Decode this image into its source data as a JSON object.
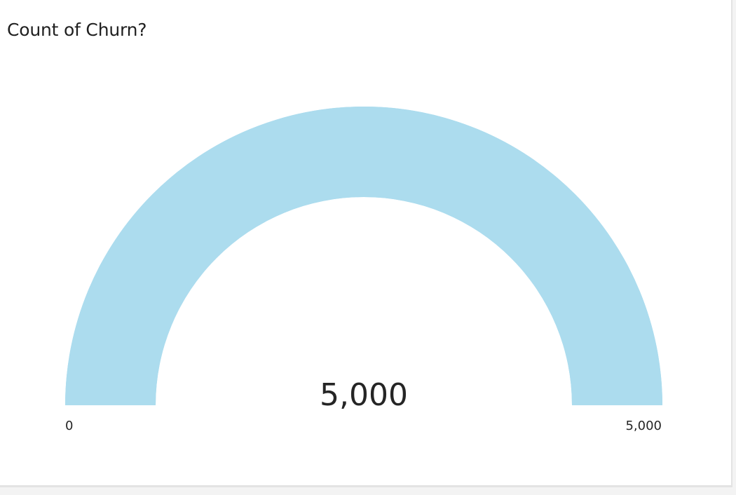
{
  "card": {
    "title": "Count of Churn?"
  },
  "chart_data": {
    "type": "gauge",
    "title": "Count of Churn?",
    "value": 5000,
    "value_label": "5,000",
    "min": 0,
    "max": 5000,
    "min_label": "0",
    "max_label": "5,000",
    "fill_color": "#acdcee",
    "track_color": "#acdcee"
  }
}
